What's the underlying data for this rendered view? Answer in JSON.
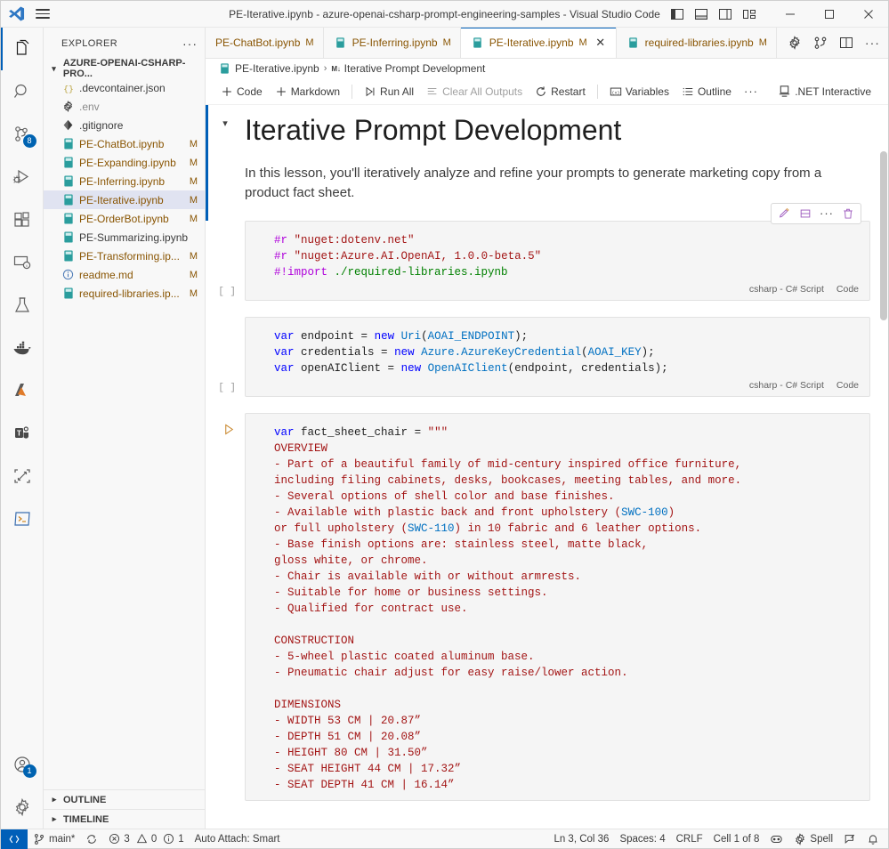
{
  "window": {
    "title": "PE-Iterative.ipynb - azure-openai-csharp-prompt-engineering-samples - Visual Studio Code",
    "menu_icon": "hamburger-menu-icon",
    "logo": "vscode-logo",
    "layout_buttons": [
      {
        "name": "toggle-primary-sidebar-icon",
        "label": "Toggle Primary Side Bar"
      },
      {
        "name": "toggle-panel-icon",
        "label": "Toggle Panel"
      },
      {
        "name": "toggle-secondary-sidebar-icon",
        "label": "Toggle Secondary Side Bar"
      },
      {
        "name": "customize-layout-icon",
        "label": "Customize Layout"
      }
    ],
    "controls": [
      {
        "name": "minimize-button",
        "glyph": "—"
      },
      {
        "name": "maximize-button",
        "glyph": "□"
      },
      {
        "name": "close-button",
        "glyph": "✕"
      }
    ]
  },
  "activity_bar": {
    "items": [
      {
        "name": "explorer",
        "icon": "files-icon",
        "active": true,
        "badge": null
      },
      {
        "name": "search",
        "icon": "search-icon",
        "active": false,
        "badge": null
      },
      {
        "name": "source-control",
        "icon": "source-control-icon",
        "active": false,
        "badge": "8"
      },
      {
        "name": "run-and-debug",
        "icon": "debug-icon",
        "active": false,
        "badge": null
      },
      {
        "name": "extensions",
        "icon": "extensions-icon",
        "active": false,
        "badge": null
      },
      {
        "name": "remote-explorer",
        "icon": "remote-monitor-icon",
        "active": false,
        "badge": null
      },
      {
        "name": "testing",
        "icon": "beaker-icon",
        "active": false,
        "badge": null
      },
      {
        "name": "docker",
        "icon": "docker-whale-icon",
        "active": false,
        "badge": null
      },
      {
        "name": "azure",
        "icon": "azure-icon",
        "active": false,
        "badge": null
      },
      {
        "name": "teams-toolkit",
        "icon": "teams-icon",
        "active": false,
        "badge": null
      },
      {
        "name": "remote-window",
        "icon": "expand-arrows-icon",
        "active": false,
        "badge": null
      },
      {
        "name": "terminal-panel",
        "icon": "terminal-icon",
        "active": false,
        "badge": null
      }
    ],
    "bottom_items": [
      {
        "name": "accounts",
        "icon": "account-icon",
        "badge": "1"
      },
      {
        "name": "manage-settings",
        "icon": "gear-icon",
        "badge": null
      }
    ]
  },
  "sidebar": {
    "title": "EXPLORER",
    "more_actions": "···",
    "folder": "AZURE-OPENAI-CSHARP-PRO...",
    "files": [
      {
        "name": ".devcontainer.json",
        "icon": "json-icon",
        "status": "",
        "selected": false,
        "muted": false
      },
      {
        "name": ".env",
        "icon": "gear-file-icon",
        "status": "",
        "selected": false,
        "muted": true
      },
      {
        "name": ".gitignore",
        "icon": "git-icon",
        "status": "",
        "selected": false,
        "muted": false
      },
      {
        "name": "PE-ChatBot.ipynb",
        "icon": "notebook-icon",
        "status": "M",
        "selected": false,
        "muted": false
      },
      {
        "name": "PE-Expanding.ipynb",
        "icon": "notebook-icon",
        "status": "M",
        "selected": false,
        "muted": false
      },
      {
        "name": "PE-Inferring.ipynb",
        "icon": "notebook-icon",
        "status": "M",
        "selected": false,
        "muted": false
      },
      {
        "name": "PE-Iterative.ipynb",
        "icon": "notebook-icon",
        "status": "M",
        "selected": true,
        "muted": false
      },
      {
        "name": "PE-OrderBot.ipynb",
        "icon": "notebook-icon",
        "status": "M",
        "selected": false,
        "muted": false
      },
      {
        "name": "PE-Summarizing.ipynb",
        "icon": "notebook-icon",
        "status": "",
        "selected": false,
        "muted": false
      },
      {
        "name": "PE-Transforming.ip...",
        "icon": "notebook-icon",
        "status": "M",
        "selected": false,
        "muted": false
      },
      {
        "name": "readme.md",
        "icon": "info-icon",
        "status": "M",
        "selected": false,
        "muted": false
      },
      {
        "name": "required-libraries.ip...",
        "icon": "notebook-icon",
        "status": "M",
        "selected": false,
        "muted": false
      }
    ],
    "bottom_sections": [
      {
        "label": "OUTLINE",
        "expanded": false
      },
      {
        "label": "TIMELINE",
        "expanded": false
      }
    ]
  },
  "tabs": [
    {
      "label": "PE-ChatBot.ipynb",
      "status": "M",
      "active": false,
      "icon": false,
      "closable": false
    },
    {
      "label": "PE-Inferring.ipynb",
      "status": "M",
      "active": false,
      "icon": true,
      "closable": false
    },
    {
      "label": "PE-Iterative.ipynb",
      "status": "M",
      "active": true,
      "icon": true,
      "closable": true
    },
    {
      "label": "required-libraries.ipynb",
      "status": "M",
      "active": false,
      "icon": true,
      "closable": false
    }
  ],
  "tab_actions": [
    {
      "name": "settings-gear-icon"
    },
    {
      "name": "source-control-compare-icon"
    },
    {
      "name": "split-editor-icon"
    },
    {
      "name": "more-actions-icon",
      "glyph": "···"
    }
  ],
  "breadcrumb": {
    "file": "PE-Iterative.ipynb",
    "separator": "›",
    "cell_kind": "M↓",
    "cell_title": "Iterative Prompt Development"
  },
  "notebook_toolbar": {
    "items": [
      {
        "name": "add-code-cell-button",
        "label": "Code",
        "icon": "plus-icon",
        "disabled": false
      },
      {
        "name": "add-markdown-cell-button",
        "label": "Markdown",
        "icon": "plus-icon",
        "disabled": false
      },
      {
        "name": "run-all-button",
        "label": "Run All",
        "icon": "run-all-icon",
        "disabled": false
      },
      {
        "name": "clear-all-outputs-button",
        "label": "Clear All Outputs",
        "icon": "clear-outputs-icon",
        "disabled": true
      },
      {
        "name": "restart-button",
        "label": "Restart",
        "icon": "restart-icon",
        "disabled": false
      },
      {
        "name": "variables-button",
        "label": "Variables",
        "icon": "variables-icon",
        "disabled": false
      },
      {
        "name": "outline-button",
        "label": "Outline",
        "icon": "outline-icon",
        "disabled": false
      },
      {
        "name": "more-toolbar-actions",
        "label": "···",
        "icon": "",
        "disabled": false
      }
    ],
    "kernel": {
      "label": ".NET Interactive",
      "icon": "kernel-icon"
    }
  },
  "cell_toolbar": [
    {
      "name": "edit-cell-button",
      "icon": "pencil-icon"
    },
    {
      "name": "split-cell-button",
      "icon": "split-cell-icon"
    },
    {
      "name": "more-cell-actions-button",
      "icon": "ellipsis-icon"
    },
    {
      "name": "delete-cell-button",
      "icon": "trash-icon"
    }
  ],
  "cells": [
    {
      "type": "markdown",
      "heading": "Iterative Prompt Development",
      "paragraph": "In this lesson, you'll iteratively analyze and refine your prompts to generate marketing copy from a product fact sheet.",
      "collapse_chevron": "⌄"
    },
    {
      "type": "code",
      "execution_count": "[ ]",
      "language": "csharp - C# Script",
      "kind_label": "Code",
      "lines": [
        "#r \"nuget:dotenv.net\"",
        "#r \"nuget:Azure.AI.OpenAI, 1.0.0-beta.5\"",
        "#!import ./required-libraries.ipynb"
      ]
    },
    {
      "type": "code",
      "execution_count": "[ ]",
      "language": "csharp - C# Script",
      "kind_label": "Code",
      "lines": [
        "var endpoint = new Uri(AOAI_ENDPOINT);",
        "var credentials = new Azure.AzureKeyCredential(AOAI_KEY);",
        "var openAIClient = new OpenAIClient(endpoint, credentials);"
      ]
    },
    {
      "type": "code",
      "execution_count": "",
      "has_run_button": true,
      "language": "csharp - C# Script",
      "kind_label": "Code",
      "lines": [
        "var fact_sheet_chair = \"\"\"",
        "OVERVIEW",
        "- Part of a beautiful family of mid-century inspired office furniture,",
        "including filing cabinets, desks, bookcases, meeting tables, and more.",
        "- Several options of shell color and base finishes.",
        "- Available with plastic back and front upholstery (SWC-100)",
        "or full upholstery (SWC-110) in 10 fabric and 6 leather options.",
        "- Base finish options are: stainless steel, matte black,",
        "gloss white, or chrome.",
        "- Chair is available with or without armrests.",
        "- Suitable for home or business settings.",
        "- Qualified for contract use.",
        "",
        "CONSTRUCTION",
        "- 5-wheel plastic coated aluminum base.",
        "- Pneumatic chair adjust for easy raise/lower action.",
        "",
        "DIMENSIONS",
        "- WIDTH 53 CM | 20.87”",
        "- DEPTH 51 CM | 20.08”",
        "- HEIGHT 80 CM | 31.50”",
        "- SEAT HEIGHT 44 CM | 17.32”",
        "- SEAT DEPTH 41 CM | 16.14”"
      ]
    }
  ],
  "status_bar": {
    "remote_icon": "remote-indicator-icon",
    "left": [
      {
        "name": "branch-status",
        "icon": "git-branch-icon",
        "label": "main*"
      },
      {
        "name": "sync-status",
        "icon": "sync-icon",
        "label": ""
      },
      {
        "name": "problems-status",
        "icon": "error-warning-icon",
        "label": "3  0  1",
        "errors": "3",
        "warnings": "0",
        "infos": "1"
      },
      {
        "name": "auto-attach-status",
        "icon": "",
        "label": "Auto Attach: Smart"
      }
    ],
    "right": [
      {
        "name": "cursor-position-status",
        "label": "Ln 3, Col 36"
      },
      {
        "name": "indentation-status",
        "label": "Spaces: 4"
      },
      {
        "name": "eol-status",
        "label": "CRLF"
      },
      {
        "name": "cell-position-status",
        "label": "Cell 1 of 8"
      },
      {
        "name": "live-share-status",
        "icon": "live-share-icon",
        "label": ""
      },
      {
        "name": "spell-checker-status",
        "icon": "spell-icon",
        "label": "Spell"
      },
      {
        "name": "feedback-status",
        "icon": "feedback-icon",
        "label": ""
      },
      {
        "name": "notifications-status",
        "icon": "bell-icon",
        "label": ""
      }
    ]
  },
  "colors": {
    "accent": "#005fb8",
    "modified": "#895503",
    "selection": "#e0e3f1",
    "code_bg": "#f5f5f5",
    "string": "#a31515",
    "keyword": "#0000ff",
    "preprocessor": "#af00db"
  }
}
